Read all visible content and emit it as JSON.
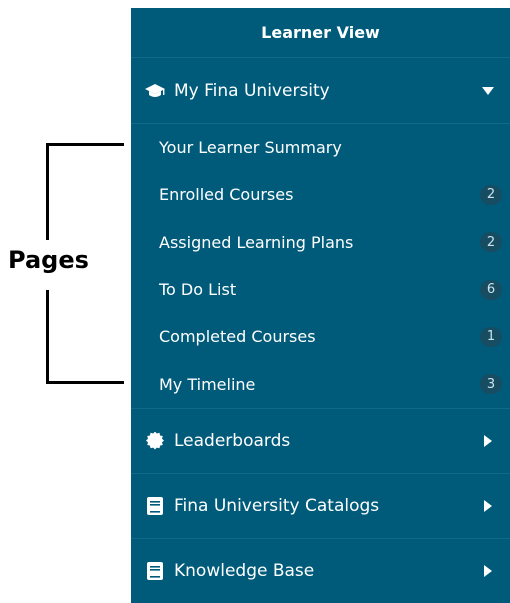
{
  "annotation": {
    "label": "Pages"
  },
  "panel": {
    "title": "Learner View",
    "sections": [
      {
        "label": "My Fina University",
        "icon": "graduation-cap-icon",
        "expanded": true,
        "items": [
          {
            "label": "Your Learner Summary",
            "badge": ""
          },
          {
            "label": "Enrolled Courses",
            "badge": "2"
          },
          {
            "label": "Assigned Learning Plans",
            "badge": "2"
          },
          {
            "label": "To Do List",
            "badge": "6"
          },
          {
            "label": "Completed Courses",
            "badge": "1"
          },
          {
            "label": "My Timeline",
            "badge": "3"
          }
        ]
      },
      {
        "label": "Leaderboards",
        "icon": "badge-certificate-icon",
        "expanded": false
      },
      {
        "label": "Fina University Catalogs",
        "icon": "book-icon",
        "expanded": false
      },
      {
        "label": "Knowledge Base",
        "icon": "book-icon",
        "expanded": false
      }
    ]
  },
  "colors": {
    "panel_bg": "#005b7b",
    "badge_bg": "#164d63",
    "text": "#ffffff"
  }
}
